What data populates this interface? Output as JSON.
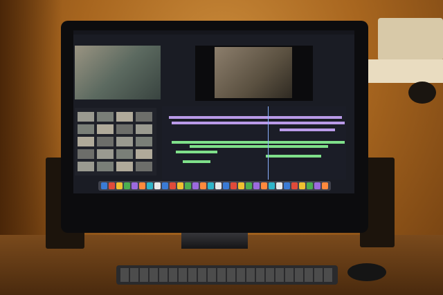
{
  "scene": {
    "description_tags": [
      "monitor",
      "desk",
      "keyboard",
      "mouse",
      "speakers"
    ],
    "app_on_screen": "video-editing-timeline",
    "colors": {
      "wall": "#b87a2e",
      "screen_bg": "#1a1c24",
      "track_purple": "#b99ae8",
      "track_green": "#7fe08a",
      "playhead": "#8ab0ff"
    }
  }
}
